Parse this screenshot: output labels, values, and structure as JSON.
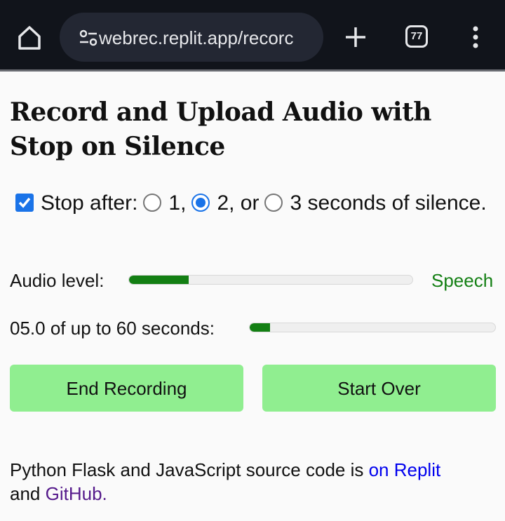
{
  "browser": {
    "url": "webrec.replit.app/recorc",
    "tab_count": "77",
    "icons": [
      "home-icon",
      "site-settings-icon",
      "new-tab-plus-icon",
      "tab-switcher-icon",
      "more-menu-icon"
    ]
  },
  "page": {
    "title": "Record and Upload Audio with Stop on Silence",
    "options": {
      "checkbox_checked": true,
      "prefix": "Stop after:",
      "radios": [
        {
          "label": "1,",
          "checked": false
        },
        {
          "label": "2, or",
          "checked": true
        },
        {
          "label": "3 seconds of silence.",
          "checked": false
        }
      ]
    },
    "audio_level": {
      "label": "Audio level:",
      "level_fraction": 0.21,
      "status": "Speech",
      "status_color": "#137f13"
    },
    "progress": {
      "label": "05.0 of up to 60 seconds:",
      "elapsed_seconds": 5.0,
      "max_seconds": 60
    },
    "buttons": {
      "end_recording": "End Recording",
      "start_over": "Start Over",
      "color": "#90ee90"
    },
    "footer": {
      "text": "Python Flask and JavaScript source code is ",
      "link_replit": "on Replit",
      "middle": " and ",
      "link_github": "GitHub."
    }
  }
}
